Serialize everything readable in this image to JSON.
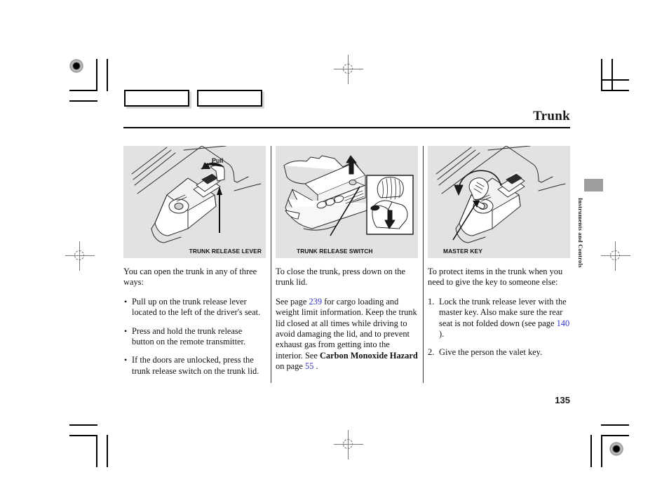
{
  "document": {
    "title": "Trunk",
    "page_number": "135",
    "side_tab_label": "Instruments and Controls"
  },
  "placeholder_boxes": [
    {
      "name": "placeholder-box-left"
    },
    {
      "name": "placeholder-box-right"
    }
  ],
  "figures": [
    {
      "id": "trunk-release-lever",
      "caption": "TRUNK RELEASE LEVER",
      "annotation": "Pull"
    },
    {
      "id": "trunk-release-switch",
      "caption": "TRUNK RELEASE SWITCH"
    },
    {
      "id": "master-key",
      "caption": "MASTER KEY"
    }
  ],
  "columns": {
    "column_1": {
      "intro": "You can open the trunk in any of three ways:",
      "bullets": [
        "Pull up on the trunk release lever located to the left of the driver's seat.",
        "Press and hold the trunk release button on the remote transmitter.",
        "If the doors are unlocked, press the trunk release switch on the trunk lid."
      ]
    },
    "column_2": {
      "paragraph_1": "To close the trunk, press down on the trunk lid.",
      "paragraph_2_part_1": "See page ",
      "paragraph_2_xref_1": "239",
      "paragraph_2_part_2": " for cargo loading and weight limit information. Keep the trunk lid closed at all times while driving to avoid damaging the lid, and to prevent exhaust gas from getting into the interior. See ",
      "paragraph_2_bold": "Carbon Monoxide Hazard",
      "paragraph_2_part_3": " on page ",
      "paragraph_2_xref_2": "55",
      "paragraph_2_part_4": " ."
    },
    "column_3": {
      "intro": "To protect items in the trunk when you need to give the key to someone else:",
      "step_1_part_1": "Lock the trunk release lever with the master key. Also make sure the rear seat is not folded down (see page ",
      "step_1_xref": "140",
      "step_1_part_2": " ).",
      "step_2": "Give the person the valet key."
    }
  },
  "colors": {
    "xref_link": "#3333cc",
    "figure_background": "#e2e2e2",
    "side_tab": "#9e9e9e",
    "rule": "#000000"
  }
}
